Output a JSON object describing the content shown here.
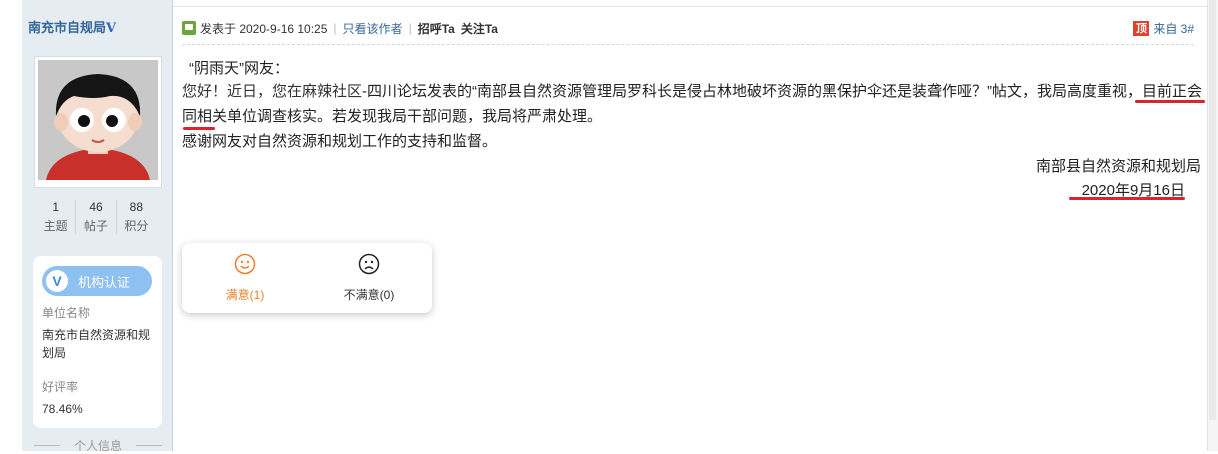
{
  "sidebar": {
    "username": "南充市自规局",
    "verified_mark": "V",
    "stats": [
      {
        "value": "1",
        "label": "主题"
      },
      {
        "value": "46",
        "label": "帖子"
      },
      {
        "value": "88",
        "label": "积分"
      }
    ],
    "certification": {
      "badge_label": "机构认证",
      "badge_icon_letter": "V",
      "unit_label": "单位名称",
      "unit_name": "南充市自然资源和规划局",
      "rating_label": "好评率",
      "rating_value": "78.46%"
    },
    "personal_info_label": "个人信息"
  },
  "post_header": {
    "posted_on": "发表于 2020-9-16 10:25",
    "only_author": "只看该作者",
    "greet": "招呼Ta",
    "follow": "关注Ta",
    "top_icon": "顶",
    "floor": "来自 3#"
  },
  "content": {
    "greeting": "“阴雨天”网友：",
    "body_hand": "您好！近日，您在麻辣社区",
    "body_main": "-四川论坛发表的“南部县自然资源管理局罗科长是侵占林地破坏资源的黑保护伞还是装聋作哑？”帖文，我局高度重视，目前正会同相关单位调查核实。若发现我局干部问题，我局将严肃处理。",
    "thanks": "感谢网友对自然资源和规划工作的支持和监督。",
    "signature_org": "南部县自然资源和规划局",
    "signature_date": "2020年9月16日"
  },
  "rating": {
    "satisfied": "满意(1)",
    "unsatisfied": "不满意(0)"
  },
  "colors": {
    "sidebar_bg": "#e5edf2",
    "link": "#336699",
    "satisfied": "#e8822a",
    "cert_badge": "#8ec0f2",
    "annotation_red": "#d9262c"
  }
}
